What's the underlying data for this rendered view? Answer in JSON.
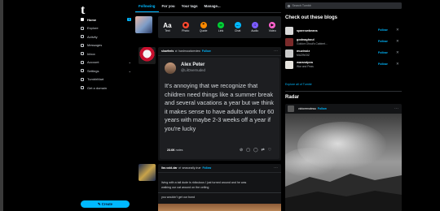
{
  "app": {
    "logo": "t"
  },
  "sidebar": {
    "items": [
      {
        "label": "Home",
        "icon": "home-icon",
        "active": true,
        "badge": "1"
      },
      {
        "label": "Explore",
        "icon": "compass-icon"
      },
      {
        "label": "Activity",
        "icon": "lightning-icon"
      },
      {
        "label": "Messages",
        "icon": "smile-icon"
      },
      {
        "label": "Inbox",
        "icon": "envelope-icon"
      },
      {
        "label": "Account",
        "icon": "person-icon",
        "chevron": "⌄"
      },
      {
        "label": "Settings",
        "icon": "gear-icon",
        "chevron": "⌄"
      },
      {
        "label": "TumblrMart",
        "icon": "shop-icon"
      },
      {
        "label": "Get a domain",
        "icon": "globe-icon"
      }
    ],
    "create_label": "✎ Create"
  },
  "tabs": [
    "Following",
    "For you",
    "Your tags",
    "Manage..."
  ],
  "compose": {
    "buttons": [
      {
        "label": "Text",
        "icon": "text-icon",
        "glyph": "Aa",
        "color": "#ffffff"
      },
      {
        "label": "Photo",
        "icon": "camera-icon",
        "glyph": "◉",
        "color": "#ff4930"
      },
      {
        "label": "Quote",
        "icon": "quote-icon",
        "glyph": "❝",
        "color": "#ff8a00"
      },
      {
        "label": "Link",
        "icon": "link-icon",
        "glyph": "∞",
        "color": "#00cf35"
      },
      {
        "label": "Chat",
        "icon": "chat-icon",
        "glyph": "…",
        "color": "#00b8ff"
      },
      {
        "label": "Audio",
        "icon": "headphones-icon",
        "glyph": "♫",
        "color": "#7c5cff"
      },
      {
        "label": "Video",
        "icon": "video-icon",
        "glyph": "▶",
        "color": "#ff62ce"
      }
    ]
  },
  "post1": {
    "reblogger": "slowfeels",
    "reblog_icon": "⇄",
    "source": "hardmoodsreview",
    "follow_label": "Follow",
    "more": "⋯",
    "tweet": {
      "name": "Alex Peter",
      "handle": "@LilOvernuded",
      "text": "It's annoying that we recognize that children need things like a summer break and several vacations a year but we think it makes sense to have adults work for 60 years with maybe 2-3 weeks off a year if you're lucky"
    },
    "notes_count": "23.6K",
    "notes_label": "notes",
    "action_icons": [
      "⊘",
      "▢",
      "◯",
      "⇄",
      "♡"
    ]
  },
  "post2": {
    "reblogger": "liar-void-dar",
    "reblog_icon": "⇄",
    "source": "seasonally-true",
    "follow_label": "Follow",
    "more": "⋯",
    "line1": "living with a tall dude is ridiculous I just turned around and he was",
    "line2": "walking our cat around on the ceiling",
    "line3": "you wouldn't get our bond"
  },
  "right": {
    "search_placeholder": "Search Tumblr",
    "blogs_title": "Check out these blogs",
    "blogs": [
      {
        "name": "sparrowbeans",
        "sub": "",
        "color": "#d9d9d9"
      },
      {
        "name": "godnaghoul",
        "sub": "Goldon Ghoul's Cabinet...",
        "color": "#7a2a2a"
      },
      {
        "name": "muzinoiz",
        "sub": "MUZINOIZ",
        "color": "#c9c9c9"
      },
      {
        "name": "warandpea",
        "sub": "War and Peas",
        "color": "#e8e6e0"
      }
    ],
    "follow_label": "Follow",
    "dismiss": "✕",
    "explore_label": "Explore all of Tumblr",
    "radar_title": "Radar",
    "radar": {
      "blog": "victoremaieau",
      "follow_label": "Follow",
      "more": "⋯"
    }
  }
}
